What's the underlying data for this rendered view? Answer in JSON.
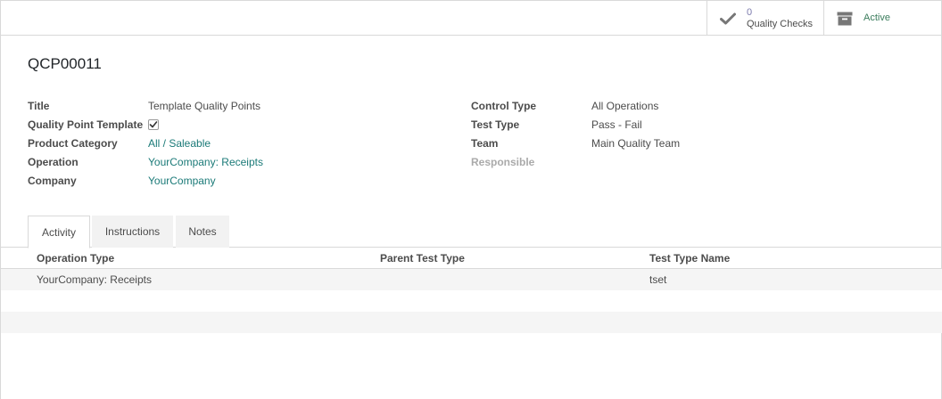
{
  "stat_buttons": {
    "quality_checks": {
      "value": "0",
      "label": "Quality Checks",
      "icon": "check-icon"
    },
    "active": {
      "label": "Active",
      "icon": "archive-icon"
    }
  },
  "record": {
    "reference": "QCP00011"
  },
  "fields_left": {
    "title": {
      "label": "Title",
      "value": "Template Quality Points"
    },
    "template": {
      "label": "Quality Point Template",
      "checked": true
    },
    "product_category": {
      "label": "Product Category",
      "value": "All / Saleable"
    },
    "operation": {
      "label": "Operation",
      "value": "YourCompany: Receipts"
    },
    "company": {
      "label": "Company",
      "value": "YourCompany"
    }
  },
  "fields_right": {
    "control_type": {
      "label": "Control Type",
      "value": "All Operations"
    },
    "test_type": {
      "label": "Test Type",
      "value": "Pass - Fail"
    },
    "team": {
      "label": "Team",
      "value": "Main Quality Team"
    },
    "responsible": {
      "label": "Responsible",
      "value": ""
    }
  },
  "tabs": [
    {
      "label": "Activity",
      "active": true
    },
    {
      "label": "Instructions",
      "active": false
    },
    {
      "label": "Notes",
      "active": false
    }
  ],
  "table": {
    "columns": [
      "Operation Type",
      "Parent Test Type",
      "Test Type Name"
    ],
    "rows": [
      [
        "YourCompany: Receipts",
        "",
        "tset"
      ]
    ]
  },
  "colors": {
    "link": "#1b7a78",
    "accent": "#7c7bad",
    "border": "#d9d9d9"
  }
}
